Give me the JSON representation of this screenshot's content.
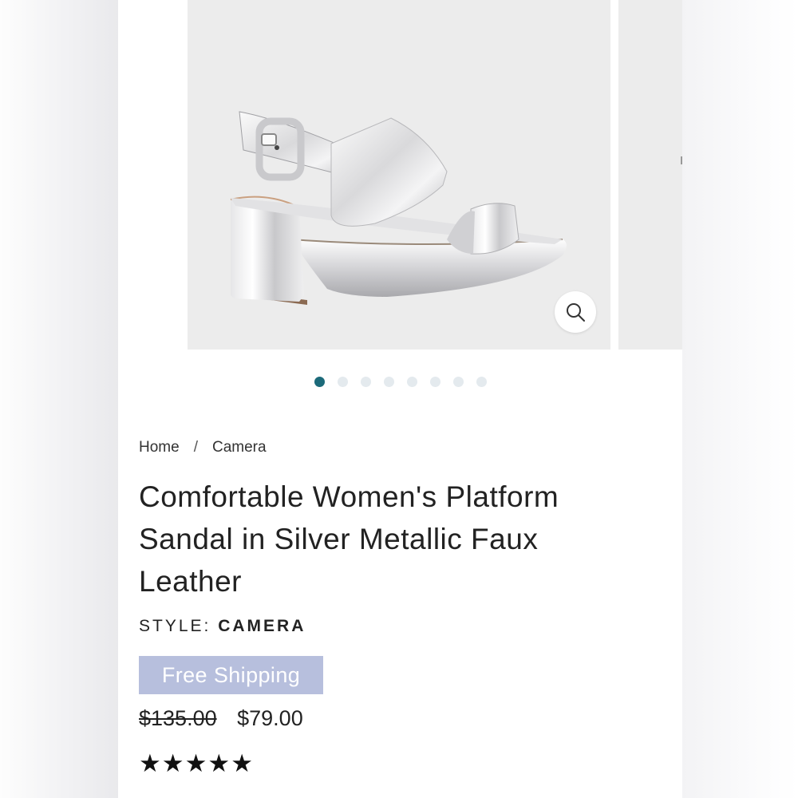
{
  "gallery": {
    "product_image_alt": "Silver metallic platform sandal",
    "zoom_icon": "search-icon",
    "dots_total": 8,
    "active_dot_index": 0
  },
  "breadcrumb": {
    "home": "Home",
    "separator": "/",
    "current": "Camera"
  },
  "product": {
    "title": "Comfortable Women's Platform Sandal in Silver Metallic Faux Leather",
    "style_label": "STYLE:",
    "style_value": "CAMERA",
    "badge": "Free Shipping",
    "original_price": "$135.00",
    "sale_price": "$79.00",
    "rating_stars": 5
  },
  "colors": {
    "accent_dot": "#1c6a7a",
    "badge_bg": "#b7bfdd"
  }
}
